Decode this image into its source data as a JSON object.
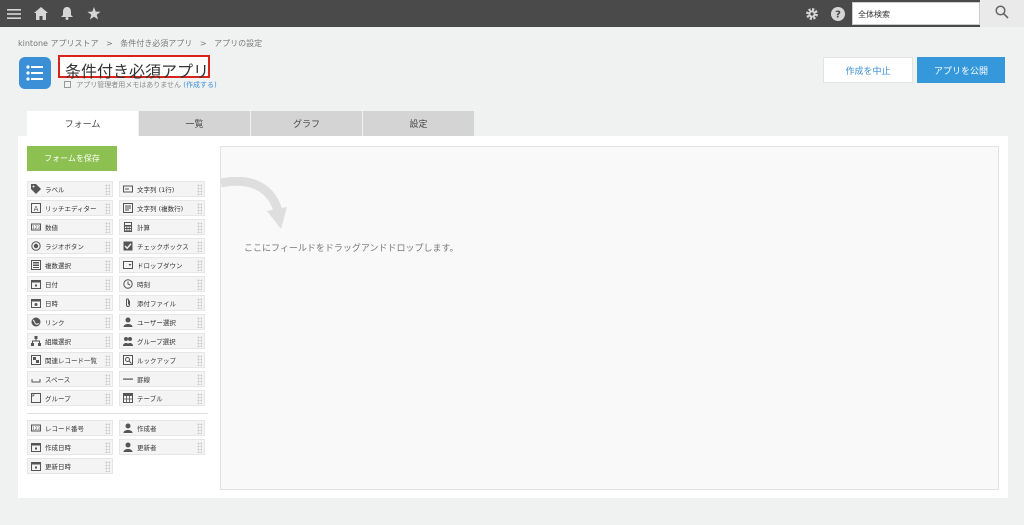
{
  "topbar": {
    "search_placeholder": "全体検索",
    "icons": [
      "menu-icon",
      "home-icon",
      "bell-icon",
      "star-icon",
      "gear-icon",
      "help-icon",
      "search-icon"
    ]
  },
  "breadcrumb": {
    "items": [
      "kintone アプリストア",
      "条件付き必須アプリ",
      "アプリの設定"
    ],
    "separator": ">"
  },
  "app": {
    "title": "条件付き必須アプリ",
    "memo_text": "アプリ管理者用メモはありません",
    "memo_link": "(作成する)"
  },
  "actions": {
    "cancel_label": "作成を中止",
    "publish_label": "アプリを公開"
  },
  "tabs": [
    {
      "label": "フォーム",
      "active": true
    },
    {
      "label": "一覧",
      "active": false
    },
    {
      "label": "グラフ",
      "active": false
    },
    {
      "label": "設定",
      "active": false
    }
  ],
  "form": {
    "save_label": "フォームを保存",
    "palette": [
      {
        "label": "ラベル",
        "icon": "tag-icon"
      },
      {
        "label": "文字列 (1行)",
        "icon": "text-single-icon"
      },
      {
        "label": "リッチエディター",
        "icon": "rich-editor-icon"
      },
      {
        "label": "文字列 (複数行)",
        "icon": "text-multi-icon"
      },
      {
        "label": "数値",
        "icon": "number-icon"
      },
      {
        "label": "計算",
        "icon": "calculator-icon"
      },
      {
        "label": "ラジオボタン",
        "icon": "radio-icon"
      },
      {
        "label": "チェックボックス",
        "icon": "checkbox-icon"
      },
      {
        "label": "複数選択",
        "icon": "multi-select-icon"
      },
      {
        "label": "ドロップダウン",
        "icon": "dropdown-icon"
      },
      {
        "label": "日付",
        "icon": "calendar-icon"
      },
      {
        "label": "時刻",
        "icon": "clock-icon"
      },
      {
        "label": "日時",
        "icon": "datetime-icon"
      },
      {
        "label": "添付ファイル",
        "icon": "paperclip-icon"
      },
      {
        "label": "リンク",
        "icon": "globe-icon"
      },
      {
        "label": "ユーザー選択",
        "icon": "user-icon"
      },
      {
        "label": "組織選択",
        "icon": "org-icon"
      },
      {
        "label": "グループ選択",
        "icon": "group-icon"
      },
      {
        "label": "関連レコード一覧",
        "icon": "related-records-icon"
      },
      {
        "label": "ルックアップ",
        "icon": "lookup-icon"
      },
      {
        "label": "スペース",
        "icon": "space-icon"
      },
      {
        "label": "罫線",
        "icon": "line-icon"
      },
      {
        "label": "グループ",
        "icon": "group-field-icon"
      },
      {
        "label": "テーブル",
        "icon": "table-icon"
      }
    ],
    "system_fields": [
      {
        "label": "レコード番号",
        "icon": "record-number-icon"
      },
      {
        "label": "作成者",
        "icon": "user-icon"
      },
      {
        "label": "作成日時",
        "icon": "calendar-icon"
      },
      {
        "label": "更新者",
        "icon": "user-icon"
      },
      {
        "label": "更新日時",
        "icon": "calendar-icon"
      }
    ],
    "drop_hint": "ここにフィールドをドラッグアンドドロップします。"
  },
  "colors": {
    "topbar": "#4a4a4a",
    "accent": "#3498db",
    "save": "#8cc152",
    "highlight": "#d9241b"
  }
}
